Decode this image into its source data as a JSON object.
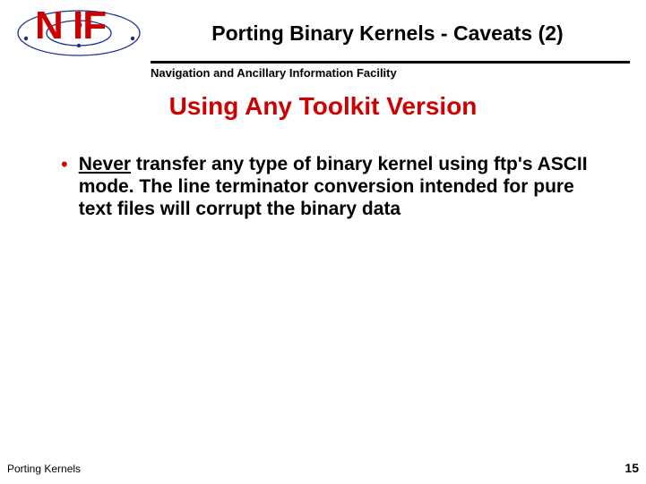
{
  "header": {
    "logo_text": "N  IF",
    "slide_title": "Porting Binary Kernels - Caveats (2)",
    "subtitle": "Navigation and Ancillary Information Facility"
  },
  "section_heading": "Using Any Toolkit Version",
  "bullet": {
    "never": "Never",
    "rest": " transfer any type of binary kernel using ftp's ASCII mode. The line terminator conversion intended for pure text files will corrupt the binary data"
  },
  "footer": {
    "left": "Porting Kernels",
    "page_number": "15"
  }
}
